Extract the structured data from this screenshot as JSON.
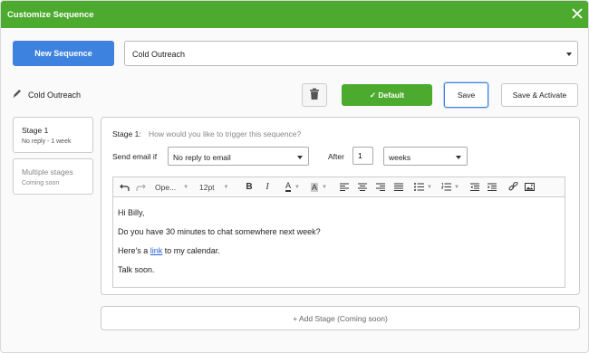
{
  "dialog": {
    "title": "Customize Sequence",
    "close_icon": "close-icon"
  },
  "top": {
    "new_sequence_label": "New Sequence",
    "sequence_select_value": "Cold Outreach"
  },
  "actions": {
    "sequence_name": "Cold Outreach",
    "default_label": "✓ Default",
    "save_label": "Save",
    "save_activate_label": "Save & Activate"
  },
  "stages": [
    {
      "title": "Stage 1",
      "subtitle": "No reply - 1 week",
      "active": true
    },
    {
      "title": "Multiple stages",
      "subtitle": "Coming soon",
      "active": false
    }
  ],
  "stage_editor": {
    "stage_label": "Stage 1:",
    "trigger_question": "How would you like to trigger this sequence?",
    "send_email_if_label": "Send email if",
    "condition_value": "No reply to email",
    "after_label": "After",
    "after_number": "1",
    "unit_value": "weeks"
  },
  "toolbar": {
    "font_value": "Ope...",
    "size_value": "12pt",
    "bold_label": "B",
    "italic_label": "I",
    "text_color_label": "A",
    "highlight_label": "A"
  },
  "email_body": {
    "line1": "Hi Billy,",
    "line2": "Do you have 30 minutes to chat somewhere next week?",
    "line3_pre": "Here's a ",
    "line3_link": "link",
    "line3_post": " to my calendar.",
    "line4": "Talk soon."
  },
  "add_stage_label": "+ Add Stage (Coming soon)",
  "colors": {
    "green": "#4caa2e",
    "blue": "#3e82e0",
    "link": "#2b5fd6"
  }
}
